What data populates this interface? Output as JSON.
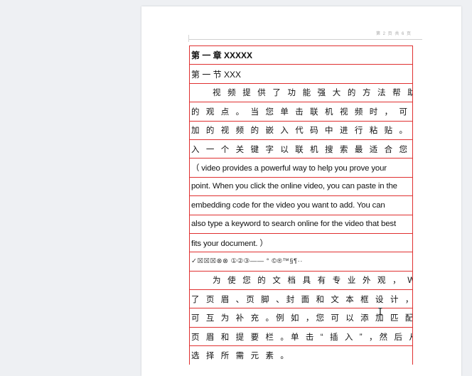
{
  "document": {
    "header_text": "第 2 页 共 6 页",
    "lines": [
      "第 一 章   XXXXX",
      "第 一 节   XXX",
      "视 频 提 供 了 功 能 强 大 的 方 法 帮 助 您 证 明 您",
      "的 观 点 。 当 您 单 击 联 机 视 频 时 ， 可 以 在 想 要 添",
      "加 的 视 频 的 嵌 入 代 码 中 进 行 粘 贴 。 您 也 可 以 键",
      "入 一 个 关 键 字 以 联 机 搜 索 最 适 合 您 的 文 档 的 。",
      "（   video provides a powerful way to help you prove your",
      "point. When you click the online video, you can paste in the",
      "embedding code for the video you want to add. You can",
      "also type a keyword to search online for the video that best",
      "fits your document. ）",
      "✓☒☒☒⊗⊗   ①②③——   °  ©®™§¶··",
      "为 使 您 的 文 档 具 有 专 业 外 观 ，   Word   提 供",
      "了 页 眉 、页 脚 、封 面 和 文 本 框 设 计 ，这 些 设 计",
      "可 互 为 补 充 。例 如 ，您 可 以 添 加 匹 配 的 封 面 、",
      "页 眉 和 提 要 栏 。单 击 “ 插 入 ” ，然 后 从 不 同 库 中",
      "选 择 所 需 元 素 。"
    ]
  },
  "cursor": {
    "icon": "text-cursor-icon",
    "glyph": "I"
  }
}
